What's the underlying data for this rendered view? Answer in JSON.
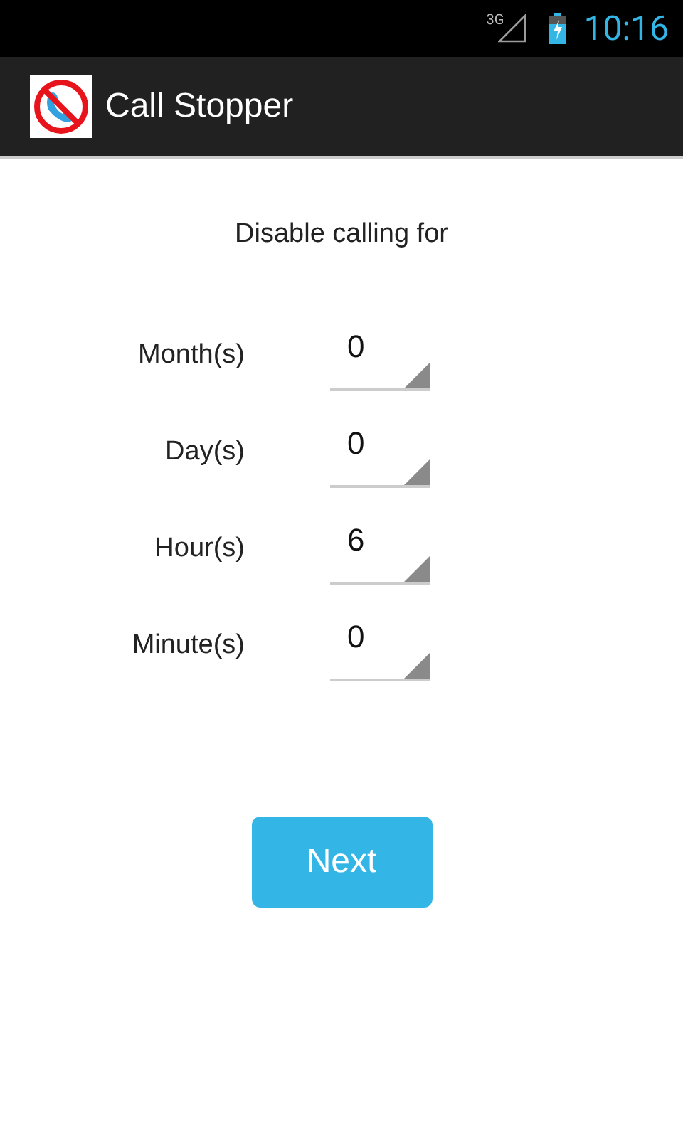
{
  "status_bar": {
    "network": "3G",
    "time": "10:16"
  },
  "action_bar": {
    "title": "Call Stopper"
  },
  "heading": "Disable calling for",
  "fields": [
    {
      "label": "Month(s)",
      "value": "0"
    },
    {
      "label": "Day(s)",
      "value": "0"
    },
    {
      "label": "Hour(s)",
      "value": "6"
    },
    {
      "label": "Minute(s)",
      "value": "0"
    }
  ],
  "button": "Next"
}
